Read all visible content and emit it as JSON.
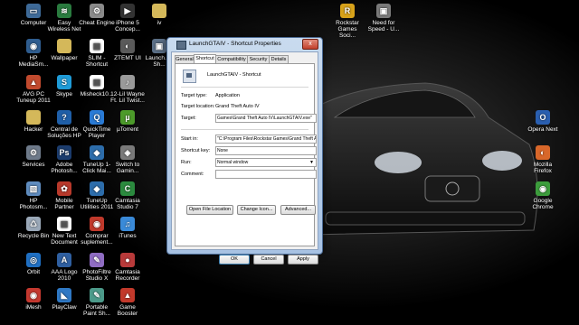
{
  "desktop": {
    "icons": [
      {
        "label": "Computer",
        "icon": "computer-icon",
        "color": "#3e6a98",
        "glyph": "▭"
      },
      {
        "label": "Easy Wireless Net",
        "icon": "wireless-icon",
        "color": "#2a7b3f",
        "glyph": "≋"
      },
      {
        "label": "Cheat Engine",
        "icon": "cheat-engine-icon",
        "color": "#8b8b8b",
        "glyph": "⚙"
      },
      {
        "label": "iPhone 5 Concep...",
        "icon": "video-file-icon",
        "color": "#333333",
        "glyph": "▶"
      },
      {
        "label": "iv",
        "icon": "folder-icon",
        "color": "#d4b85a",
        "glyph": ""
      },
      {
        "label": "HP MediaSm...",
        "icon": "media-icon",
        "color": "#2f5d8f",
        "glyph": "◉"
      },
      {
        "label": "Wallpaper",
        "icon": "folder-icon",
        "color": "#d4b85a",
        "glyph": ""
      },
      {
        "label": "SLIM - Shortcut",
        "icon": "slim-icon",
        "color": "#ffffff",
        "glyph": "▤"
      },
      {
        "label": "ZTEMT UI",
        "icon": "ztemt-icon",
        "color": "#5a5a5a",
        "glyph": "◐"
      },
      {
        "label": "Launch... - Sh...",
        "icon": "launch-icon",
        "color": "#5b6f86",
        "glyph": "▣"
      },
      {
        "label": "AVG PC Tuneup 2011",
        "icon": "avg-icon",
        "color": "#c14a2e",
        "glyph": "▲"
      },
      {
        "label": "Skype",
        "icon": "skype-icon",
        "color": "#1f9bd7",
        "glyph": "S"
      },
      {
        "label": "Misheck10...",
        "icon": "document-icon",
        "color": "#ffffff",
        "glyph": "▤"
      },
      {
        "label": "12-Lil Wayne Ft. Lil Twist...",
        "icon": "audio-file-icon",
        "color": "#9a9a9a",
        "glyph": "♪"
      },
      {
        "label": "Hacker",
        "icon": "folder-icon",
        "color": "#d4b85a",
        "glyph": ""
      },
      {
        "label": "Central de Soluções HP",
        "icon": "hp-icon",
        "color": "#1f5fa8",
        "glyph": "?"
      },
      {
        "label": "QuickTime Player",
        "icon": "quicktime-icon",
        "color": "#2a7bd6",
        "glyph": "Q"
      },
      {
        "label": "µTorrent",
        "icon": "utorrent-icon",
        "color": "#4c9a2a",
        "glyph": "µ"
      },
      {
        "label": "Services",
        "icon": "services-icon",
        "color": "#6e7a8a",
        "glyph": "⚙"
      },
      {
        "label": "Adobe Photosh...",
        "icon": "photoshop-icon",
        "color": "#1c3d6e",
        "glyph": "Ps"
      },
      {
        "label": "TuneUp 1-Click Mai...",
        "icon": "tuneup-icon",
        "color": "#2d6dab",
        "glyph": "◆"
      },
      {
        "label": "Switch to Gamin...",
        "icon": "game-mode-icon",
        "color": "#7a7a7a",
        "glyph": "◈"
      },
      {
        "label": "HP Photosm...",
        "icon": "hp-photosmart-icon",
        "color": "#5f8cbf",
        "glyph": "▧"
      },
      {
        "label": "Mobile Partner",
        "icon": "mobile-partner-icon",
        "color": "#b8392b",
        "glyph": "✿"
      },
      {
        "label": "TuneUp Utilities 2011",
        "icon": "tuneup-utilities-icon",
        "color": "#2d6dab",
        "glyph": "◆"
      },
      {
        "label": "Camtasia Studio 7",
        "icon": "camtasia-icon",
        "color": "#2b8a3e",
        "glyph": "C"
      },
      {
        "label": "Recycle Bin",
        "icon": "recycle-bin-icon",
        "color": "#9aa8b8",
        "glyph": "♺"
      },
      {
        "label": "New Text Document",
        "icon": "text-document-icon",
        "color": "#ffffff",
        "glyph": "▤"
      },
      {
        "label": "Comprar suplement...",
        "icon": "shopping-icon",
        "color": "#c0392b",
        "glyph": "◉"
      },
      {
        "label": "iTunes",
        "icon": "itunes-icon",
        "color": "#3a8ad8",
        "glyph": "♫"
      },
      {
        "label": "Orbit",
        "icon": "orbit-icon",
        "color": "#1f6fc2",
        "glyph": "◎"
      },
      {
        "label": "AAA Logo 2010",
        "icon": "aaa-logo-icon",
        "color": "#2f5fa0",
        "glyph": "A"
      },
      {
        "label": "PhotoFiltre Studio X",
        "icon": "photofiltre-icon",
        "color": "#8f6cc2",
        "glyph": "✎"
      },
      {
        "label": "Camtasia Recorder",
        "icon": "camtasia-recorder-icon",
        "color": "#b83a3a",
        "glyph": "●"
      },
      {
        "label": "iMesh",
        "icon": "imesh-icon",
        "color": "#c4382f",
        "glyph": "◉"
      },
      {
        "label": "PlayClaw",
        "icon": "playclaw-icon",
        "color": "#2f78c4",
        "glyph": "◣"
      },
      {
        "label": "Portable Paint Sh...",
        "icon": "paint-shop-icon",
        "color": "#4c9a8a",
        "glyph": "✎"
      },
      {
        "label": "Game Booster",
        "icon": "game-booster-icon",
        "color": "#c2392b",
        "glyph": "▲"
      },
      {
        "label": "Rockstar Games Soci...",
        "icon": "rockstar-icon",
        "color": "#d7a21a",
        "glyph": "R"
      },
      {
        "label": "Need for Speed - U...",
        "icon": "nfs-icon",
        "color": "#7a7a7a",
        "glyph": "▣"
      },
      {
        "label": "Opera Next",
        "icon": "opera-icon",
        "color": "#2a5fb0",
        "glyph": "O"
      },
      {
        "label": "Mozilla Firefox",
        "icon": "firefox-icon",
        "color": "#d8672a",
        "glyph": "◐"
      },
      {
        "label": "Google Chrome",
        "icon": "chrome-icon",
        "color": "#3c9d3c",
        "glyph": "◉"
      }
    ]
  },
  "dialog": {
    "title": "LaunchGTAIV - Shortcut Properties",
    "close_glyph": "x",
    "tabs": [
      "General",
      "Shortcut",
      "Compatibility",
      "Security",
      "Details"
    ],
    "active_tab": "Shortcut",
    "shortcut_name": "LaunchGTAIV - Shortcut",
    "fields": {
      "target_type_label": "Target type:",
      "target_type_value": "Application",
      "target_location_label": "Target location:",
      "target_location_value": "Grand Theft Auto IV",
      "target_label": "Target:",
      "target_value": "Games\\Grand Theft Auto IV\\LaunchGTAIV.exe\"",
      "start_in_label": "Start in:",
      "start_in_value": "\"C:\\Program Files\\Rockstar Games\\Grand Theft A",
      "shortcut_key_label": "Shortcut key:",
      "shortcut_key_value": "None",
      "run_label": "Run:",
      "run_value": "Normal window",
      "comment_label": "Comment:",
      "comment_value": ""
    },
    "buttons": {
      "open_file_location": "Open File Location",
      "change_icon": "Change Icon...",
      "advanced": "Advanced...",
      "ok": "OK",
      "cancel": "Cancel",
      "apply": "Apply"
    }
  }
}
